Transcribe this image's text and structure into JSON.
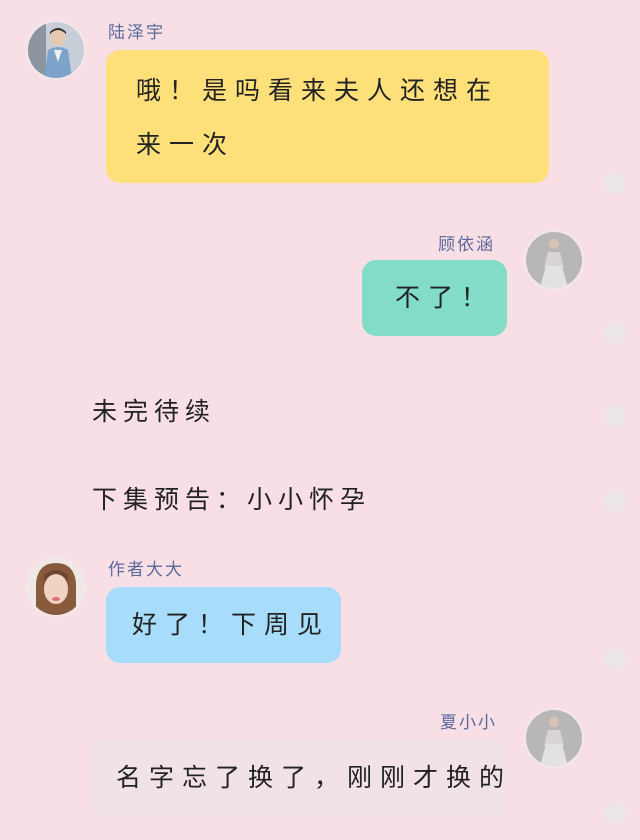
{
  "messages": [
    {
      "sender": "陆泽宇",
      "text": "哦！是吗看来夫人还想在来一次",
      "side": "left",
      "bubble_color": "#fde07a"
    },
    {
      "sender": "顾依涵",
      "text": "不了！",
      "side": "right",
      "bubble_color": "#82dcc8"
    },
    {
      "sender": "作者大大",
      "text": "好了！下周见",
      "side": "left",
      "bubble_color": "#a8dcfb"
    },
    {
      "sender": "夏小小",
      "text": "名字忘了换了，刚刚才换的",
      "side": "right",
      "bubble_color": "#f0e2e6"
    }
  ],
  "narration": {
    "line1": "未完待续",
    "line2": "下集预告：小小怀孕"
  },
  "colors": {
    "background": "#f8dfe6",
    "name_text": "#5a6a9c"
  }
}
